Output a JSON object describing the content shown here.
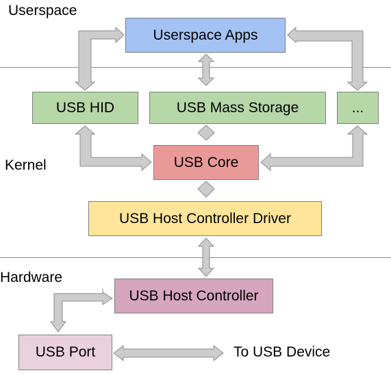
{
  "layers": {
    "userspace": "Userspace",
    "kernel": "Kernel",
    "hardware": "Hardware"
  },
  "components": {
    "userspace_apps": {
      "label": "Userspace Apps",
      "color": "#a4c2f4"
    },
    "usb_hid": {
      "label": "USB HID",
      "color": "#b6d7a8"
    },
    "usb_mass_storage": {
      "label": "USB Mass Storage",
      "color": "#b6d7a8"
    },
    "other_drivers": {
      "label": "...",
      "color": "#b6d7a8"
    },
    "usb_core": {
      "label": "USB Core",
      "color": "#ea9999"
    },
    "usb_hcd": {
      "label": "USB Host Controller Driver",
      "color": "#ffe599"
    },
    "usb_host_controller": {
      "label": "USB Host Controller",
      "color": "#d5a6bd"
    },
    "usb_port": {
      "label": "USB Port",
      "color": "#ead1dc"
    }
  },
  "external": {
    "to_device": "To USB Device"
  },
  "connections": [
    [
      "usb_hid",
      "userspace_apps"
    ],
    [
      "usb_mass_storage",
      "userspace_apps"
    ],
    [
      "other_drivers",
      "userspace_apps"
    ],
    [
      "usb_hid",
      "usb_core"
    ],
    [
      "usb_mass_storage",
      "usb_core"
    ],
    [
      "other_drivers",
      "usb_core"
    ],
    [
      "usb_core",
      "usb_hcd"
    ],
    [
      "usb_hcd",
      "usb_host_controller"
    ],
    [
      "usb_host_controller",
      "usb_port"
    ],
    [
      "usb_port",
      "to_device"
    ]
  ]
}
